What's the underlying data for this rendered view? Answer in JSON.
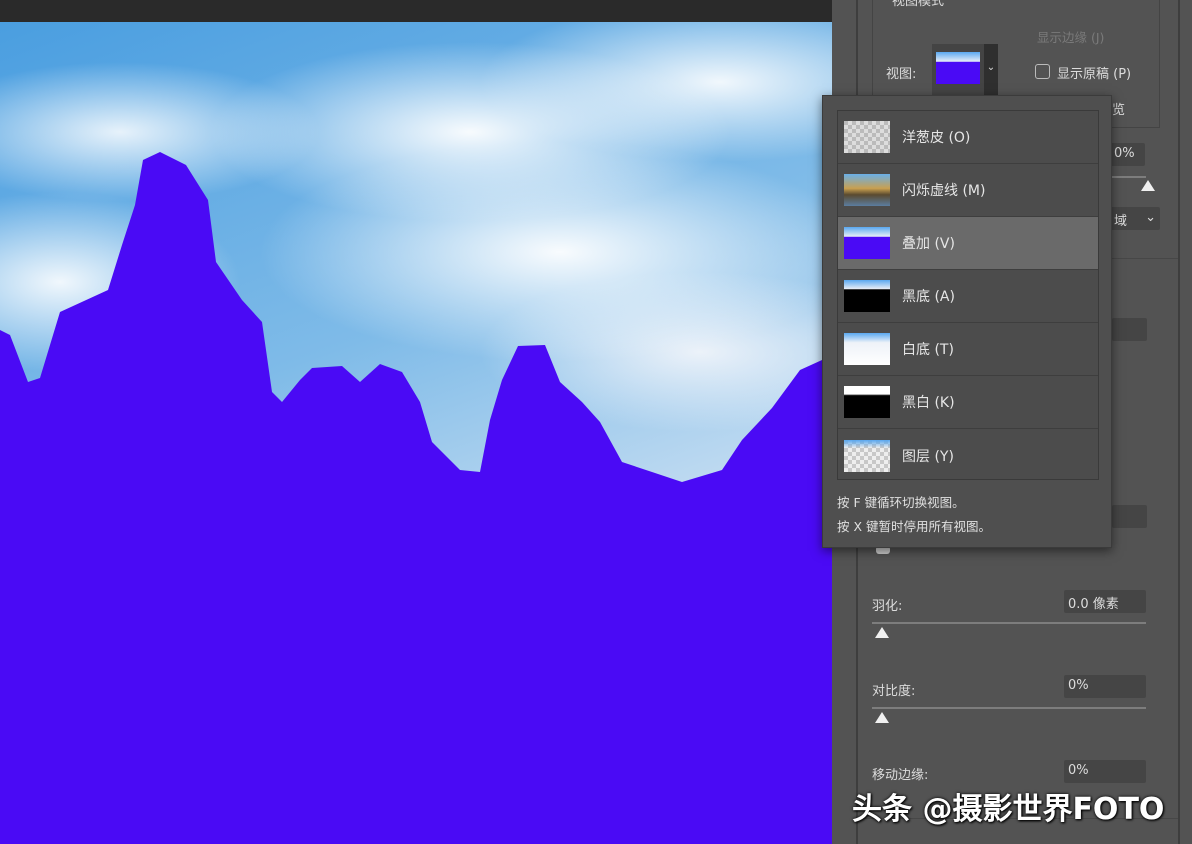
{
  "colors": {
    "overlay": "#4a0af5",
    "panel": "#535353",
    "menu_selected": "#6a6a6a"
  },
  "view_mode": {
    "section_title": "视图模式",
    "show_edge": "显示边缘 (J)",
    "view_label": "视图:",
    "show_original": "显示原稿 (P)",
    "hq_preview_partial": "览",
    "show_original_checked": false
  },
  "hidden_controls": {
    "opacity_value": "0%",
    "select_partial": "域"
  },
  "view_menu": {
    "items": [
      {
        "label": "洋葱皮 (O)",
        "icon": "onion-skin-thumb",
        "selected": false
      },
      {
        "label": "闪烁虚线 (M)",
        "icon": "marching-ants-thumb",
        "selected": false
      },
      {
        "label": "叠加 (V)",
        "icon": "overlay-thumb",
        "selected": true
      },
      {
        "label": "黑底 (A)",
        "icon": "on-black-thumb",
        "selected": false
      },
      {
        "label": "白底 (T)",
        "icon": "on-white-thumb",
        "selected": false
      },
      {
        "label": "黑白 (K)",
        "icon": "black-white-thumb",
        "selected": false
      },
      {
        "label": "图层 (Y)",
        "icon": "on-layers-thumb",
        "selected": false
      }
    ],
    "hint1": "按 F 键循环切换视图。",
    "hint2": "按 X 键暂时停用所有视图。"
  },
  "global_refinements": {
    "feather_label": "羽化:",
    "feather_value": "0.0 像素",
    "feather": 0,
    "contrast_label": "对比度:",
    "contrast_value": "0%",
    "contrast": 0,
    "shift_edge_label": "移动边缘:",
    "shift_edge_value": "0%"
  },
  "watermark": "头条 @摄影世界FOTO"
}
